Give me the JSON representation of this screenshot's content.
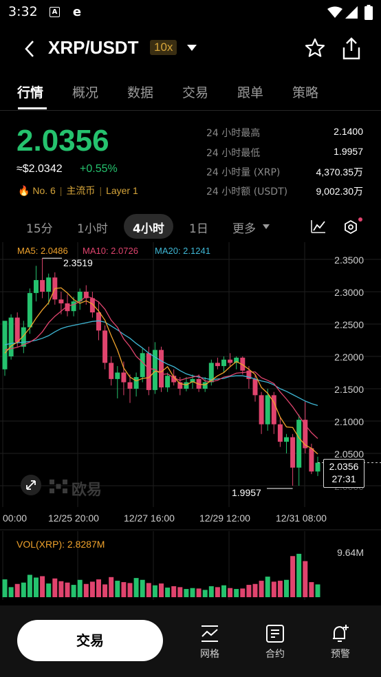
{
  "status_bar": {
    "time": "3:32"
  },
  "header": {
    "pair": "XRP/USDT",
    "leverage": "10x"
  },
  "tabs": [
    "行情",
    "概况",
    "数据",
    "交易",
    "跟单",
    "策略"
  ],
  "ticker": {
    "price": "2.0356",
    "fiat": "≈$2.0342",
    "change": "+0.55%",
    "rank": "No. 6",
    "tag1": "主流币",
    "tag2": "Layer 1",
    "stats": [
      {
        "label": "24 小时最高",
        "value": "2.1400"
      },
      {
        "label": "24 小时最低",
        "value": "1.9957"
      },
      {
        "label": "24 小时量 (XRP)",
        "value": "4,370.35万"
      },
      {
        "label": "24 小时额 (USDT)",
        "value": "9,002.30万"
      }
    ]
  },
  "intervals": [
    "15分",
    "1小时",
    "4小时",
    "1日",
    "更多"
  ],
  "indicators": {
    "ma5": "MA5: 2.0486",
    "ma10": "MA10: 2.0726",
    "ma20": "MA20: 2.1241",
    "vol": "VOL(XRP): 2.8287M",
    "vol_max": "9.64M"
  },
  "watermark": "欧易",
  "current": {
    "price": "2.0356",
    "countdown": "27:31"
  },
  "colors": {
    "up": "#25c26e",
    "down": "#e0446e",
    "ma5": "#f0a32c",
    "ma10": "#e0446e",
    "ma20": "#3fb8d6"
  },
  "chart_data": {
    "type": "candlestick",
    "y_ticks": [
      "2.3500",
      "2.3000",
      "2.2500",
      "2.2000",
      "2.1500",
      "2.1000",
      "2.0500",
      "2.0000"
    ],
    "x_ticks": [
      "00:00",
      "12/25 20:00",
      "12/27 16:00",
      "12/29 12:00",
      "12/31 08:00"
    ],
    "ylim": [
      1.975,
      2.365
    ],
    "high_label": "2.3519",
    "low_label": "1.9957",
    "candles": [
      {
        "o": 2.18,
        "h": 2.215,
        "l": 2.17,
        "c": 2.255
      },
      {
        "o": 2.2,
        "h": 2.265,
        "l": 2.195,
        "c": 2.26
      },
      {
        "o": 2.26,
        "h": 2.268,
        "l": 2.215,
        "c": 2.222
      },
      {
        "o": 2.215,
        "h": 2.255,
        "l": 2.205,
        "c": 2.245
      },
      {
        "o": 2.245,
        "h": 2.305,
        "l": 2.235,
        "c": 2.298
      },
      {
        "o": 2.298,
        "h": 2.34,
        "l": 2.285,
        "c": 2.318
      },
      {
        "o": 2.318,
        "h": 2.352,
        "l": 2.29,
        "c": 2.3
      },
      {
        "o": 2.3,
        "h": 2.328,
        "l": 2.28,
        "c": 2.322
      },
      {
        "o": 2.322,
        "h": 2.33,
        "l": 2.28,
        "c": 2.288
      },
      {
        "o": 2.288,
        "h": 2.3,
        "l": 2.265,
        "c": 2.282
      },
      {
        "o": 2.282,
        "h": 2.296,
        "l": 2.262,
        "c": 2.27
      },
      {
        "o": 2.27,
        "h": 2.292,
        "l": 2.262,
        "c": 2.285
      },
      {
        "o": 2.285,
        "h": 2.305,
        "l": 2.272,
        "c": 2.3
      },
      {
        "o": 2.3,
        "h": 2.31,
        "l": 2.28,
        "c": 2.29
      },
      {
        "o": 2.29,
        "h": 2.3,
        "l": 2.26,
        "c": 2.268
      },
      {
        "o": 2.268,
        "h": 2.285,
        "l": 2.225,
        "c": 2.24
      },
      {
        "o": 2.24,
        "h": 2.248,
        "l": 2.18,
        "c": 2.19
      },
      {
        "o": 2.19,
        "h": 2.2,
        "l": 2.155,
        "c": 2.165
      },
      {
        "o": 2.165,
        "h": 2.185,
        "l": 2.135,
        "c": 2.175
      },
      {
        "o": 2.175,
        "h": 2.192,
        "l": 2.14,
        "c": 2.16
      },
      {
        "o": 2.16,
        "h": 2.172,
        "l": 2.128,
        "c": 2.15
      },
      {
        "o": 2.15,
        "h": 2.175,
        "l": 2.138,
        "c": 2.168
      },
      {
        "o": 2.168,
        "h": 2.212,
        "l": 2.16,
        "c": 2.205
      },
      {
        "o": 2.205,
        "h": 2.215,
        "l": 2.14,
        "c": 2.148
      },
      {
        "o": 2.148,
        "h": 2.222,
        "l": 2.142,
        "c": 2.21
      },
      {
        "o": 2.21,
        "h": 2.215,
        "l": 2.145,
        "c": 2.152
      },
      {
        "o": 2.152,
        "h": 2.175,
        "l": 2.145,
        "c": 2.17
      },
      {
        "o": 2.17,
        "h": 2.18,
        "l": 2.155,
        "c": 2.16
      },
      {
        "o": 2.16,
        "h": 2.168,
        "l": 2.14,
        "c": 2.15
      },
      {
        "o": 2.15,
        "h": 2.168,
        "l": 2.146,
        "c": 2.16
      },
      {
        "o": 2.16,
        "h": 2.172,
        "l": 2.15,
        "c": 2.165
      },
      {
        "o": 2.165,
        "h": 2.172,
        "l": 2.145,
        "c": 2.15
      },
      {
        "o": 2.15,
        "h": 2.168,
        "l": 2.145,
        "c": 2.16
      },
      {
        "o": 2.16,
        "h": 2.195,
        "l": 2.155,
        "c": 2.19
      },
      {
        "o": 2.19,
        "h": 2.198,
        "l": 2.18,
        "c": 2.185
      },
      {
        "o": 2.185,
        "h": 2.2,
        "l": 2.175,
        "c": 2.195
      },
      {
        "o": 2.195,
        "h": 2.205,
        "l": 2.185,
        "c": 2.19
      },
      {
        "o": 2.19,
        "h": 2.2,
        "l": 2.18,
        "c": 2.198
      },
      {
        "o": 2.198,
        "h": 2.2,
        "l": 2.172,
        "c": 2.178
      },
      {
        "o": 2.178,
        "h": 2.185,
        "l": 2.15,
        "c": 2.165
      },
      {
        "o": 2.165,
        "h": 2.172,
        "l": 2.13,
        "c": 2.14
      },
      {
        "o": 2.14,
        "h": 2.145,
        "l": 2.08,
        "c": 2.095
      },
      {
        "o": 2.095,
        "h": 2.15,
        "l": 2.085,
        "c": 2.14
      },
      {
        "o": 2.14,
        "h": 2.145,
        "l": 2.08,
        "c": 2.095
      },
      {
        "o": 2.095,
        "h": 2.105,
        "l": 2.06,
        "c": 2.068
      },
      {
        "o": 2.068,
        "h": 2.08,
        "l": 2.05,
        "c": 2.075
      },
      {
        "o": 2.075,
        "h": 2.08,
        "l": 2.0,
        "c": 2.028
      },
      {
        "o": 2.028,
        "h": 2.11,
        "l": 2.0,
        "c": 2.102
      },
      {
        "o": 2.102,
        "h": 2.13,
        "l": 2.05,
        "c": 2.058
      },
      {
        "o": 2.058,
        "h": 2.065,
        "l": 2.018,
        "c": 2.022
      },
      {
        "o": 2.022,
        "h": 2.045,
        "l": 2.015,
        "c": 2.0356
      }
    ],
    "volume": [
      3.9,
      2.2,
      2.9,
      3.2,
      4.9,
      4.3,
      4.6,
      3.0,
      4.1,
      3.5,
      3.2,
      2.7,
      3.8,
      2.9,
      3.4,
      3.9,
      2.8,
      4.4,
      3.6,
      3.3,
      3.1,
      4.2,
      3.8,
      3.1,
      2.6,
      3.0,
      2.1,
      2.4,
      2.2,
      1.8,
      2.0,
      1.9,
      1.6,
      2.4,
      2.2,
      2.6,
      2.0,
      1.8,
      1.9,
      2.7,
      2.9,
      3.6,
      4.5,
      3.4,
      3.6,
      3.8,
      9.0,
      9.5,
      7.9,
      3.3,
      2.8
    ],
    "ma5": [
      2.205,
      2.216,
      2.222,
      2.232,
      2.244,
      2.259,
      2.272,
      2.283,
      2.305,
      2.306,
      2.298,
      2.288,
      2.282,
      2.286,
      2.281,
      2.27,
      2.256,
      2.232,
      2.21,
      2.182,
      2.168,
      2.162,
      2.166,
      2.167,
      2.177,
      2.176,
      2.184,
      2.168,
      2.158,
      2.156,
      2.161,
      2.157,
      2.156,
      2.163,
      2.17,
      2.175,
      2.184,
      2.192,
      2.187,
      2.18,
      2.172,
      2.152,
      2.143,
      2.129,
      2.106,
      2.091,
      2.09,
      2.074,
      2.063,
      2.058,
      2.049
    ],
    "ma10": [
      2.21,
      2.212,
      2.214,
      2.218,
      2.222,
      2.228,
      2.238,
      2.252,
      2.262,
      2.27,
      2.278,
      2.28,
      2.285,
      2.293,
      2.29,
      2.284,
      2.273,
      2.256,
      2.245,
      2.227,
      2.215,
      2.2,
      2.191,
      2.181,
      2.18,
      2.172,
      2.173,
      2.167,
      2.163,
      2.166,
      2.168,
      2.17,
      2.162,
      2.161,
      2.163,
      2.168,
      2.17,
      2.174,
      2.175,
      2.176,
      2.176,
      2.167,
      2.163,
      2.158,
      2.145,
      2.134,
      2.122,
      2.108,
      2.094,
      2.082,
      2.073
    ],
    "ma20": [
      2.218,
      2.22,
      2.221,
      2.222,
      2.223,
      2.225,
      2.228,
      2.232,
      2.238,
      2.243,
      2.246,
      2.248,
      2.25,
      2.252,
      2.254,
      2.255,
      2.253,
      2.247,
      2.241,
      2.234,
      2.228,
      2.22,
      2.213,
      2.205,
      2.199,
      2.193,
      2.188,
      2.184,
      2.178,
      2.173,
      2.17,
      2.168,
      2.166,
      2.164,
      2.165,
      2.166,
      2.169,
      2.17,
      2.17,
      2.168,
      2.165,
      2.162,
      2.16,
      2.156,
      2.15,
      2.146,
      2.141,
      2.136,
      2.131,
      2.127,
      2.124
    ]
  }
}
